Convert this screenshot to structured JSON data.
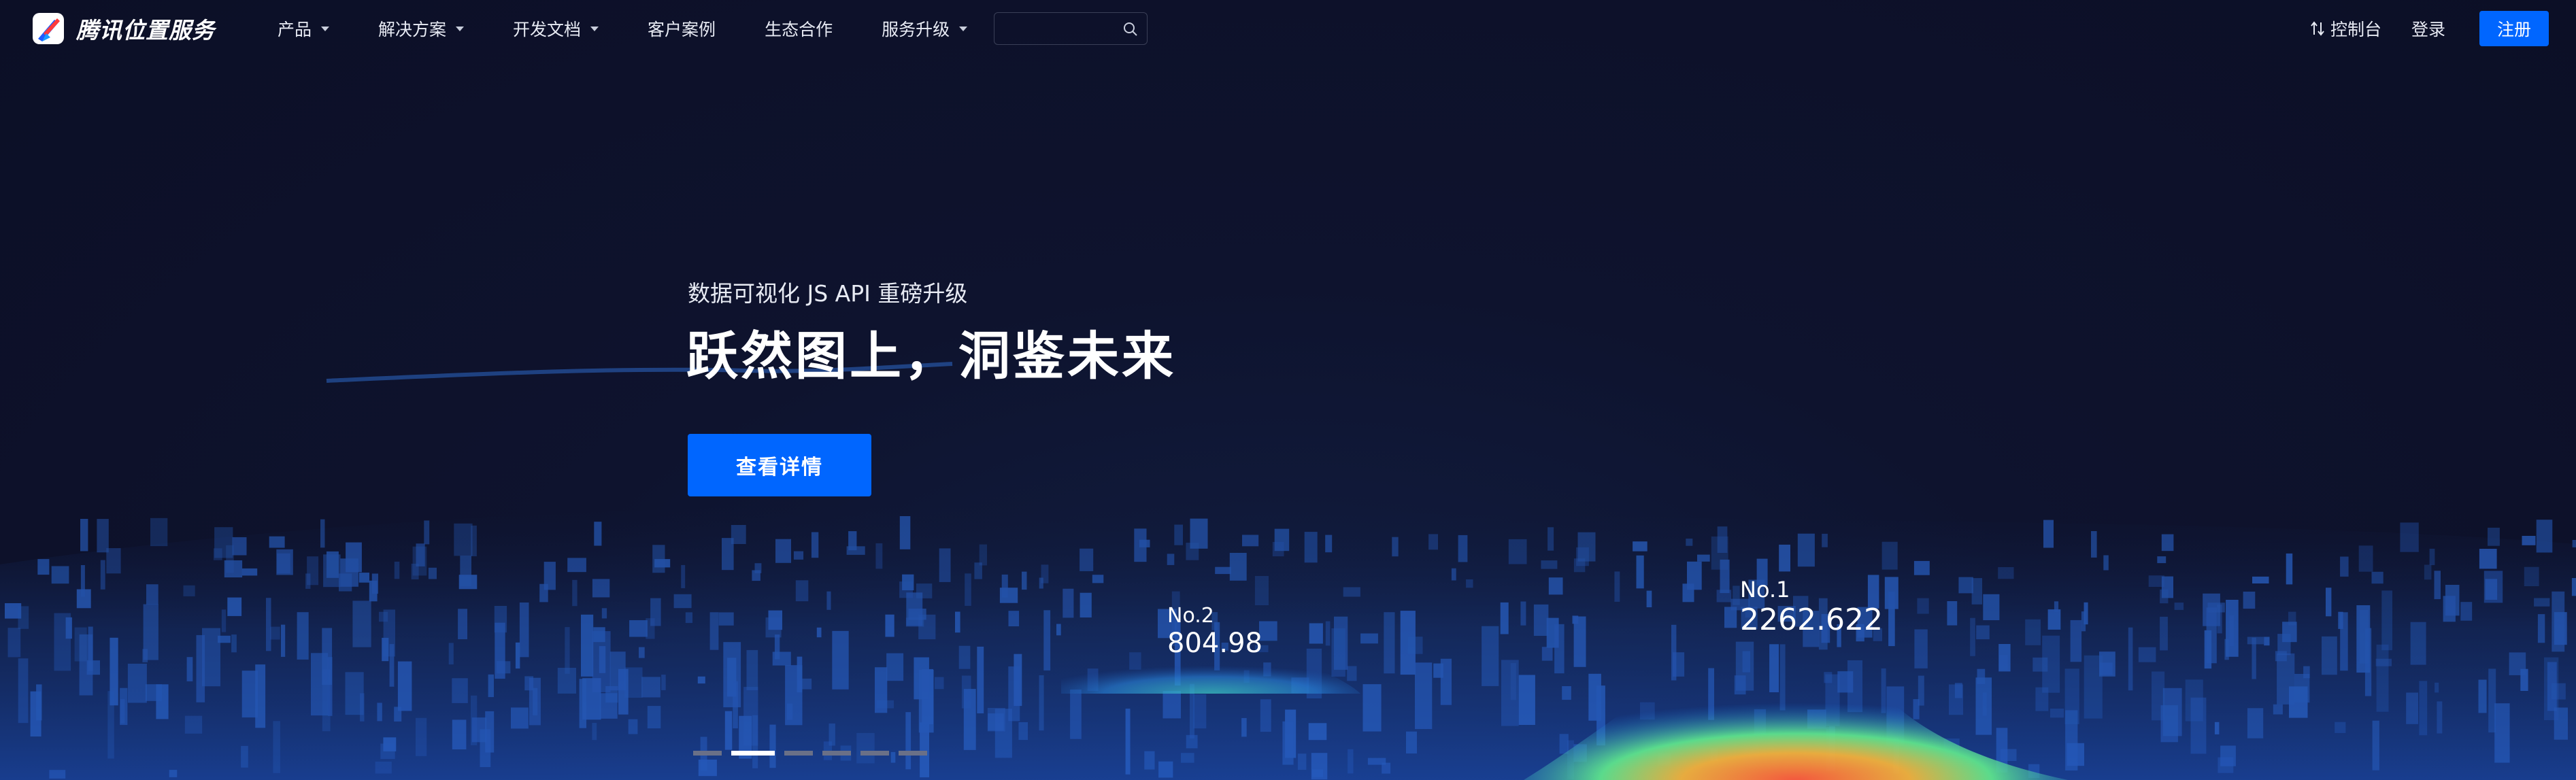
{
  "brand": {
    "name": "腾讯位置服务",
    "colors": {
      "primary": "#0066ff",
      "background": "#0d1027"
    }
  },
  "nav": {
    "items": [
      {
        "label": "产品",
        "has_dropdown": true
      },
      {
        "label": "解决方案",
        "has_dropdown": true
      },
      {
        "label": "开发文档",
        "has_dropdown": true
      },
      {
        "label": "客户案例",
        "has_dropdown": false
      },
      {
        "label": "生态合作",
        "has_dropdown": false
      },
      {
        "label": "服务升级",
        "has_dropdown": true
      }
    ],
    "search": {
      "placeholder": "",
      "value": "",
      "icon": "search-icon"
    },
    "console_label": "控制台",
    "login_label": "登录",
    "register_label": "注册"
  },
  "hero": {
    "subtitle": "数据可视化 JS API 重磅升级",
    "title": "跃然图上，洞鉴未来",
    "cta_label": "查看详情",
    "ranks": [
      {
        "no": "No.2",
        "value": "804.98"
      },
      {
        "no": "No.1",
        "value": "2262.622"
      }
    ]
  },
  "carousel": {
    "slide_count": 6,
    "active_index": 1
  }
}
